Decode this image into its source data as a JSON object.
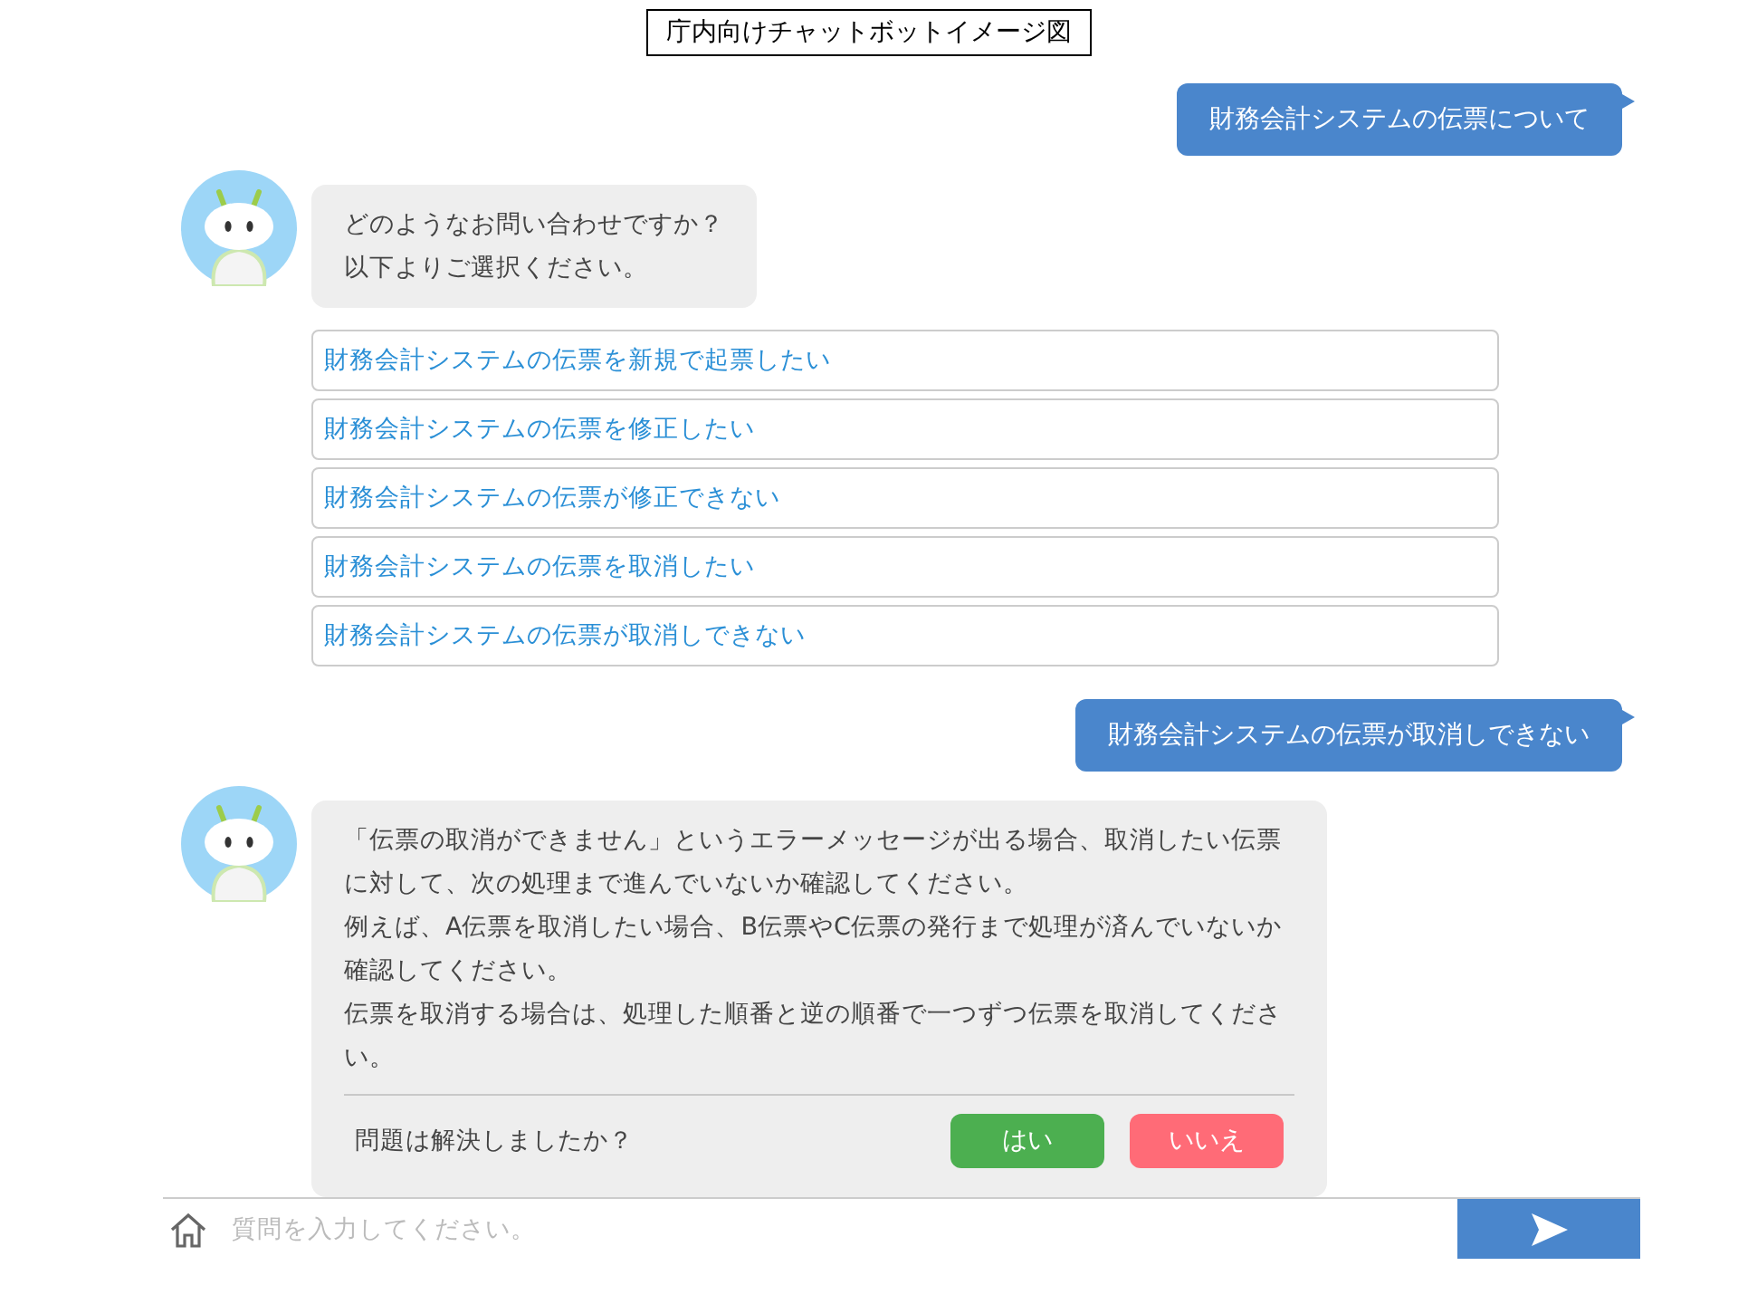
{
  "title": "庁内向けチャットボットイメージ図",
  "messages": [
    {
      "kind": "user",
      "text": "財務会計システムの伝票について"
    },
    {
      "kind": "bot",
      "paragraphs": [
        "どのようなお問い合わせですか？",
        "以下よりご選択ください。"
      ]
    },
    {
      "kind": "options",
      "items": [
        "財務会計システムの伝票を新規で起票したい",
        "財務会計システムの伝票を修正したい",
        "財務会計システムの伝票が修正できない",
        "財務会計システムの伝票を取消したい",
        "財務会計システムの伝票が取消しできない"
      ]
    },
    {
      "kind": "user",
      "text": "財務会計システムの伝票が取消しできない"
    },
    {
      "kind": "bot",
      "paragraphs": [
        "「伝票の取消ができません」というエラーメッセージが出る場合、取消したい伝票に対して、次の処理まで進んでいないか確認してください。",
        "例えば、A伝票を取消したい場合、B伝票やC伝票の発行まで処理が済んでいないか確認してください。",
        "伝票を取消する場合は、処理した順番と逆の順番で一つずつ伝票を取消してください。"
      ],
      "question": "問題は解決しましたか？",
      "buttons": [
        {
          "label": "はい",
          "kind": "yes"
        },
        {
          "label": "いいえ",
          "kind": "no"
        }
      ]
    }
  ],
  "input": {
    "placeholder": "質問を入力してください。"
  }
}
